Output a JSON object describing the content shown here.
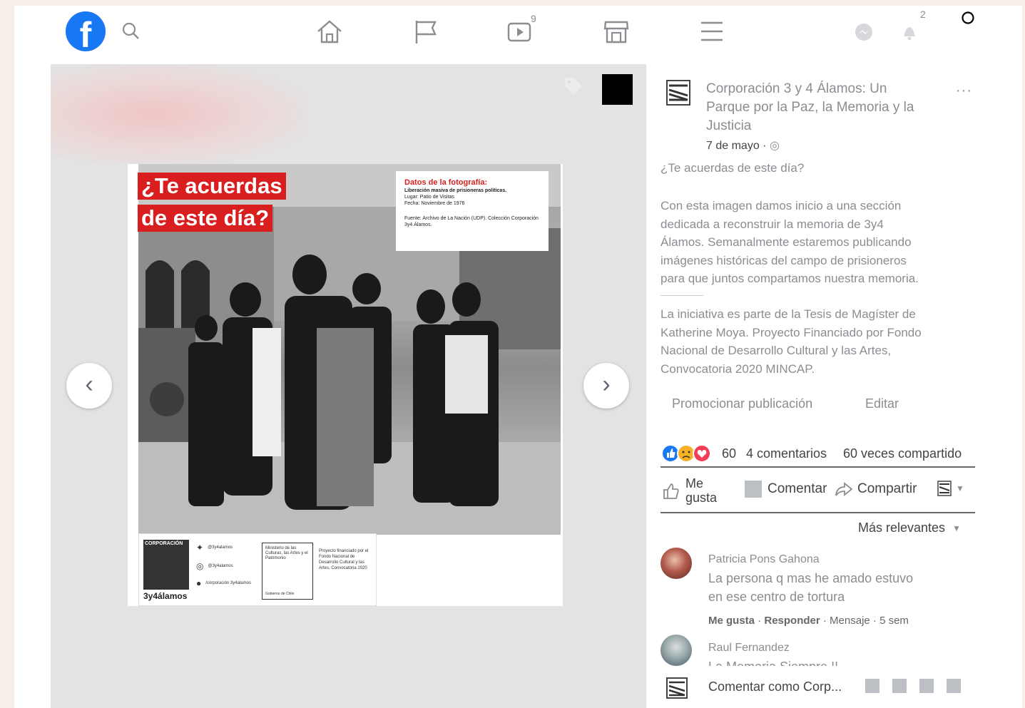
{
  "topbar": {
    "logo": "f",
    "video_badge": "9",
    "notifications_badge": "2",
    "icons": [
      "search-icon",
      "home-icon",
      "flag-icon",
      "video-icon",
      "marketplace-icon",
      "menu-icon",
      "messenger-icon",
      "bell-icon"
    ]
  },
  "photo": {
    "title_line1": "¿Te acuerdas",
    "title_line2": "de este día?",
    "data_title": "Datos de la fotografía:",
    "data_subtitle": "Liberación masiva de prisioneras políticas.",
    "data_place": "Lugar: Patio de Visitas",
    "data_date": "Fecha: Noviembre de 1976",
    "data_source": "Fuente: Archivo de La Nación (UDP). Colección Corporación 3y4 Álamos.",
    "credits_org_top": "CORPORACIÓN",
    "credits_org_bottom": "3y4álamos",
    "credits_twitter": "@3y4alamos",
    "credits_instagram": "@3y4alamos",
    "credits_facebook": "/corporación 3y4alamos",
    "credits_ministry": "Ministerio de las Culturas, las Artes y el Patrimonio",
    "credits_ministry_footer": "Gobierno de Chile",
    "credits_project": "Proyecto financiado por el Fondo Nacional de Desarrollo Cultural y las Artes, Convocatoria 2020"
  },
  "post": {
    "page_name_line1": "Corporación 3 y 4 Álamos: Un",
    "page_name_line2": "Parque por la Paz, la Memoria y la",
    "page_name_line3": "Justicia",
    "date": "7 de mayo ·",
    "more": "···",
    "text_1": "¿Te acuerdas de este día?",
    "text_2a": "Con esta imagen damos inicio a una sección",
    "text_2b": "dedicada a reconstruir la memoria de 3y4",
    "text_2c": "Álamos. Semanalmente estaremos publicando",
    "text_2d": "imágenes históricas del campo de prisioneros",
    "text_2e": "para que juntos compartamos nuestra memoria.",
    "text_3a": "La iniciativa es parte de la Tesis de Magíster de",
    "text_3b": "Katherine Moya. Proyecto Financiado por Fondo",
    "text_3c": "Nacional de Desarrollo Cultural y las Artes,",
    "text_3d": "Convocatoria 2020 MINCAP.",
    "promote": "Promocionar publicación",
    "edit": "Editar",
    "reactions_count": "60",
    "comments_count": "4 comentarios",
    "shares_count": "60 veces compartido",
    "like_line1": "Me",
    "like_line2": "gusta",
    "comment": "Comentar",
    "share": "Compartir",
    "sort": "Más relevantes"
  },
  "comments": [
    {
      "author": "Patricia Pons Gahona",
      "text_line1": "La persona q mas he amado estuvo",
      "text_line2": "en ese centro de tortura",
      "like": "Me gusta",
      "reply": "Responder",
      "meta": "· Mensaje · 5 sem"
    },
    {
      "author": "Raul Fernandez",
      "text_line1": "La Memoria Siempre !!"
    }
  ],
  "composer": {
    "placeholder": "Comentar como Corp..."
  },
  "colors": {
    "brand": "#1877f2",
    "title_red": "#d81e1e",
    "gray_text": "#8a8d91"
  }
}
